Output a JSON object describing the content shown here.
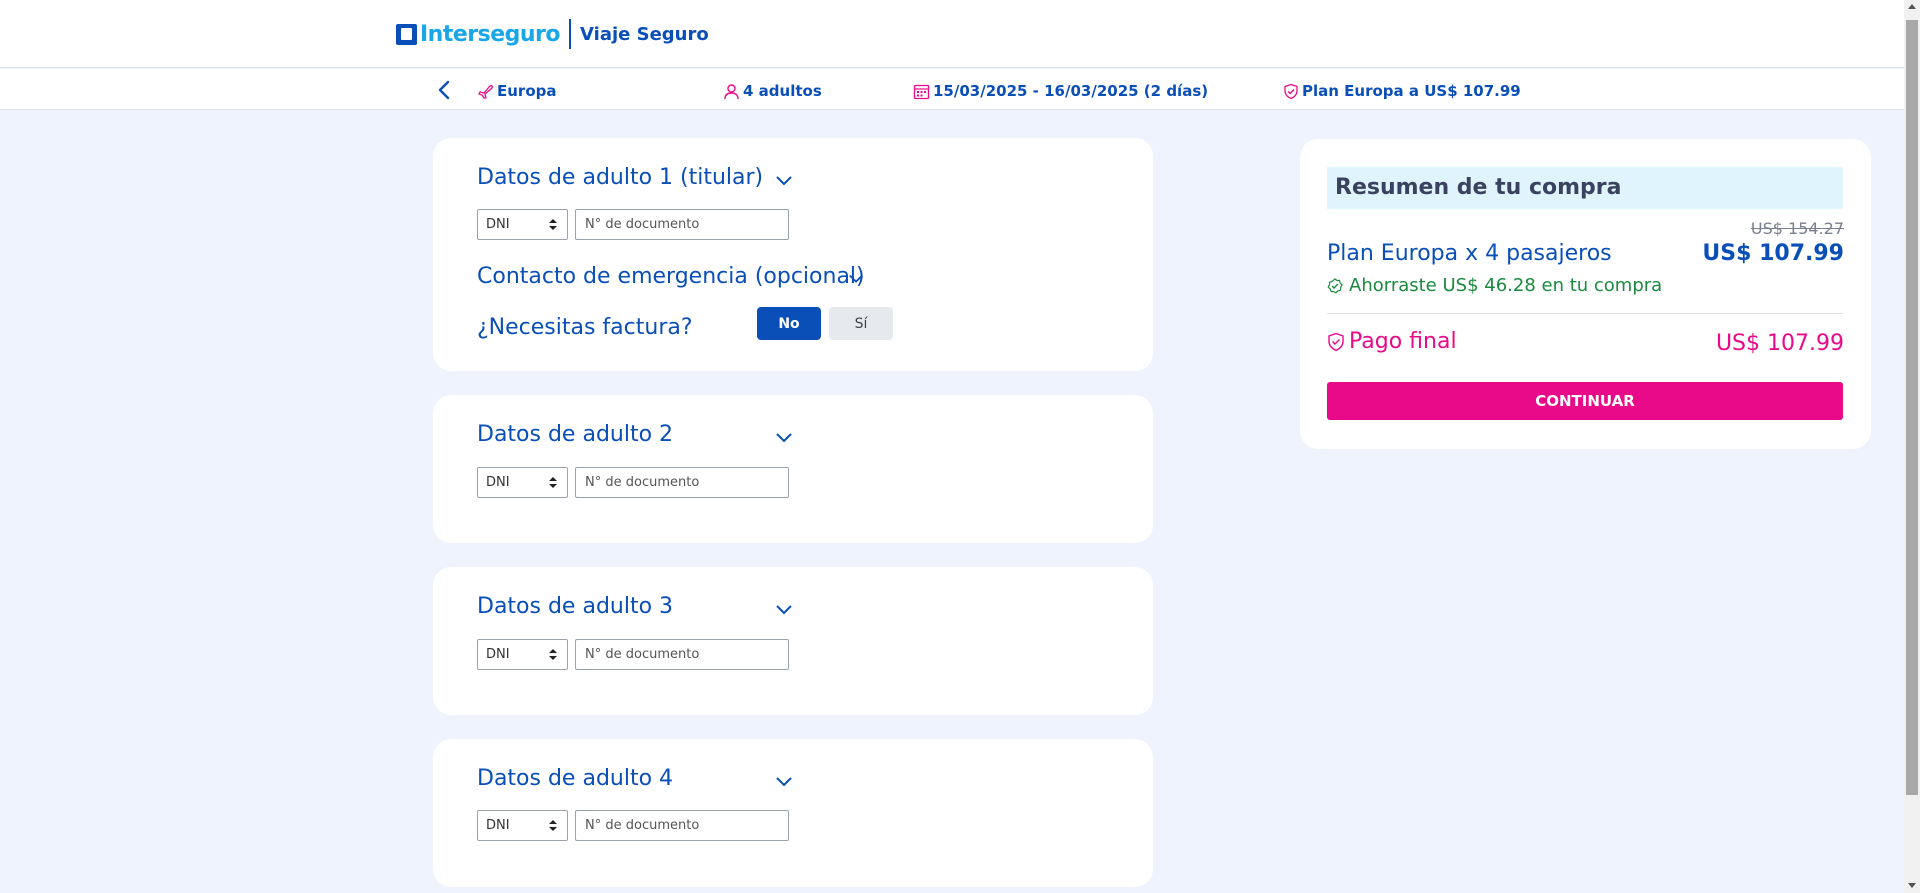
{
  "header": {
    "brand": "Interseguro",
    "product": "Viaje Seguro"
  },
  "trip": {
    "destination": "Europa",
    "travelers": "4 adultos",
    "dates": "15/03/2025 - 16/03/2025 (2 días)",
    "plan": "Plan Europa a US$ 107.99"
  },
  "adults": [
    {
      "title": "Datos de adulto 1 (titular)",
      "doc_type": "DNI",
      "doc_placeholder": "N° de documento"
    },
    {
      "title": "Datos de adulto 2",
      "doc_type": "DNI",
      "doc_placeholder": "N° de documento"
    },
    {
      "title": "Datos de adulto 3",
      "doc_type": "DNI",
      "doc_placeholder": "N° de documento"
    },
    {
      "title": "Datos de adulto 4",
      "doc_type": "DNI",
      "doc_placeholder": "N° de documento"
    }
  ],
  "emergency": {
    "title": "Contacto de emergencia (opcional)"
  },
  "invoice": {
    "label": "¿Necesitas factura?",
    "no": "No",
    "yes": "Sí",
    "selected": "No"
  },
  "summary": {
    "title": "Resumen de tu compra",
    "old_price": "US$ 154.27",
    "plan_line": "Plan Europa x 4 pasajeros",
    "plan_price": "US$ 107.99",
    "savings": "Ahorraste US$ 46.28 en tu compra",
    "final_label": "Pago final",
    "final_price": "US$ 107.99",
    "cta": "CONTINUAR"
  },
  "colors": {
    "primary": "#0a4fb8",
    "accent": "#e90a8a",
    "brand_light": "#1aa7e8",
    "success": "#1a8a3e",
    "background": "#eef3fd"
  }
}
